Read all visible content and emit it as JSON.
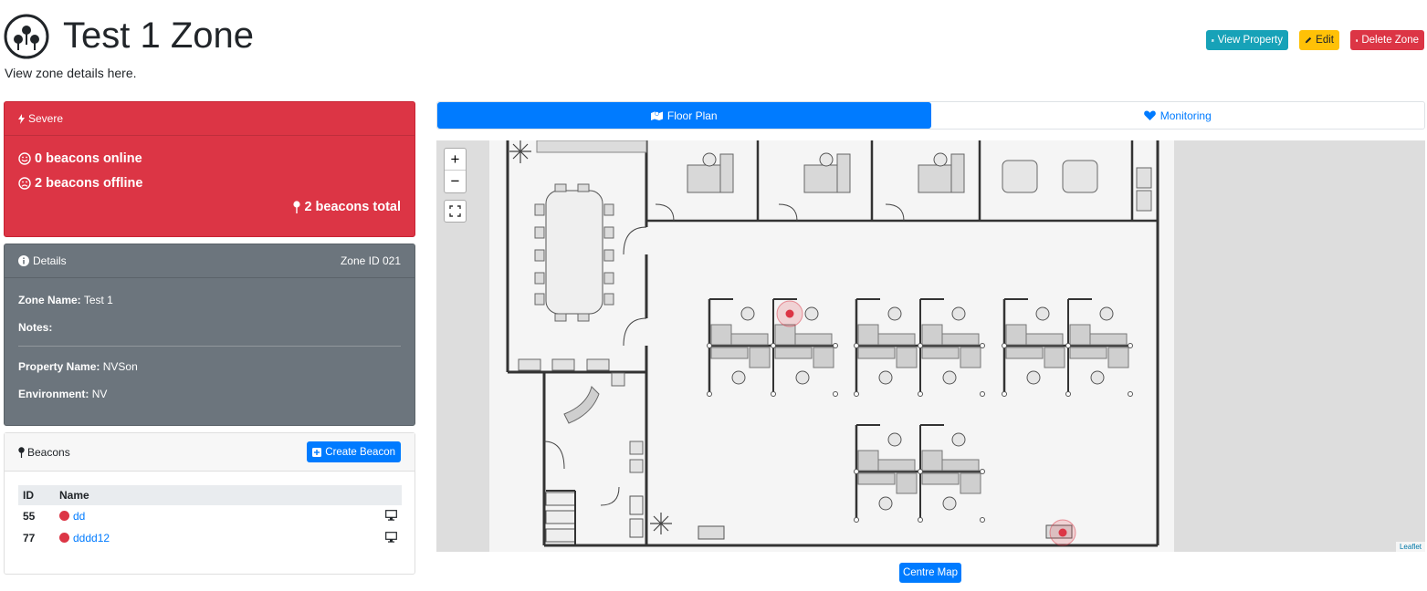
{
  "header": {
    "title": "Test 1 Zone",
    "subtitle": "View zone details here."
  },
  "actions": {
    "view_property": "View Property",
    "edit": "Edit",
    "delete_zone": "Delete Zone"
  },
  "severity": {
    "label": "Severe",
    "online": "0 beacons online",
    "offline": "2 beacons offline",
    "total": "2 beacons total"
  },
  "details": {
    "title": "Details",
    "zone_id": "Zone ID 021",
    "zone_name_label": "Zone Name:",
    "zone_name": "Test 1",
    "notes_label": "Notes:",
    "notes": "",
    "property_name_label": "Property Name:",
    "property_name": "NVSon",
    "environment_label": "Environment:",
    "environment": "NV"
  },
  "beacons": {
    "title": "Beacons",
    "create_label": "Create Beacon",
    "columns": [
      "ID",
      "Name"
    ],
    "rows": [
      {
        "id": "55",
        "name": "dd",
        "status_color": "#dc3545"
      },
      {
        "id": "77",
        "name": "dddd12",
        "status_color": "#dc3545"
      }
    ]
  },
  "tabs": [
    {
      "label": "Floor Plan",
      "active": true
    },
    {
      "label": "Monitoring",
      "active": false
    }
  ],
  "map": {
    "zoom_in": "+",
    "zoom_out": "−",
    "attribution": "Leaflet",
    "centre_label": "Centre Map"
  },
  "colors": {
    "primary": "#007bff",
    "danger": "#dc3545",
    "warning": "#ffc107",
    "info": "#17a2b8",
    "secondary": "#6c757d"
  }
}
